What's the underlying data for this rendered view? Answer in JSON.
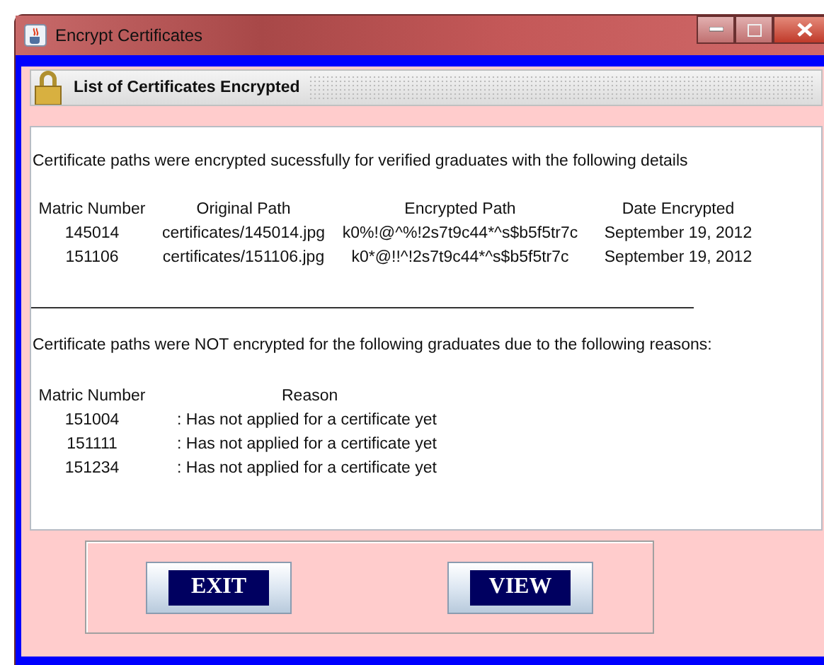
{
  "window": {
    "title": "Encrypt Certificates"
  },
  "header": {
    "title": "List of Certificates Encrypted"
  },
  "encrypted": {
    "message": "Certificate paths were encrypted sucessfully for verified graduates with the following details",
    "columns": [
      "Matric Number",
      "Original Path",
      "Encrypted Path",
      "Date Encrypted"
    ],
    "rows": [
      {
        "matric": "145014",
        "original_path": "certificates/145014.jpg",
        "encrypted_path": "k0%!@^%!2s7t9c44*^s$b5f5tr7c",
        "date": "September 19, 2012"
      },
      {
        "matric": "151106",
        "original_path": "certificates/151106.jpg",
        "encrypted_path": "k0*@!!^!2s7t9c44*^s$b5f5tr7c",
        "date": "September 19, 2012"
      }
    ]
  },
  "not_encrypted": {
    "message": "Certificate paths were NOT encrypted for the following graduates due to the following reasons:",
    "columns": [
      "Matric Number",
      "Reason"
    ],
    "rows": [
      {
        "matric": "151004",
        "reason": ":  Has not applied for a certificate yet"
      },
      {
        "matric": "151111",
        "reason": ":  Has not applied for a certificate yet"
      },
      {
        "matric": "151234",
        "reason": ":  Has not applied for a certificate yet"
      }
    ]
  },
  "buttons": [
    "EXIT",
    "VIEW"
  ]
}
